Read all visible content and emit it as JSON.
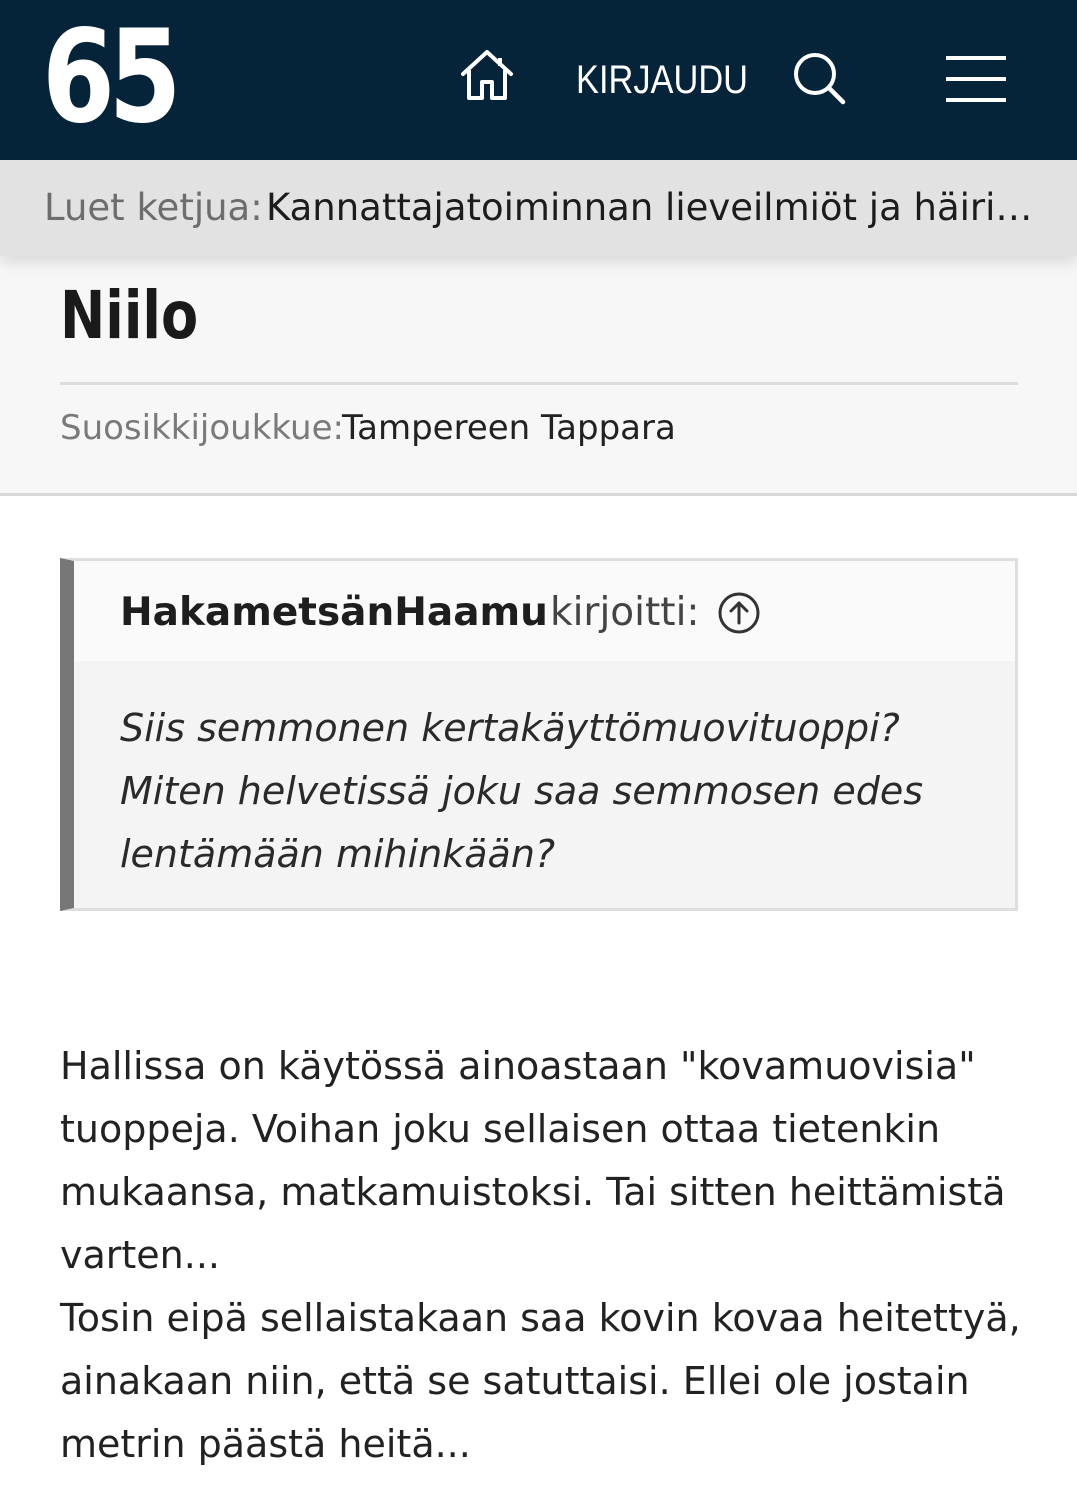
{
  "header": {
    "logo": "65",
    "login_label": "KIRJAUDU",
    "icons": [
      "home-icon",
      "search-icon",
      "hamburger-menu-icon"
    ],
    "bg_color": "#052439"
  },
  "thread": {
    "prefix": "Luet ketjua:",
    "title": "Kannattajatoiminnan lieveilmiöt ja häiriö..."
  },
  "profile": {
    "username": "Niilo",
    "favorite_team_label": "Suosikkijoukkue:",
    "favorite_team": "Tampereen Tappara"
  },
  "quote": {
    "author": "HakametsänHaamu",
    "wrote_label": "kirjoitti:",
    "lines": [
      "Siis semmonen kertakäyttömuovituoppi?",
      "Miten helvetissä joku saa semmosen edes",
      "lentämään mihinkään?"
    ]
  },
  "post": {
    "paragraphs": [
      "Hallissa on käytössä ainoastaan \"kovamuovisia\" tuoppeja. Voihan joku sellaisen ottaa tietenkin mukaansa, matkamuistoksi. Tai sitten heittämistä varten...",
      "Tosin eipä sellaistakaan saa kovin kovaa heitettyä, ainakaan niin, että se satuttaisi. Ellei ole jostain metrin päästä heitä..."
    ]
  }
}
